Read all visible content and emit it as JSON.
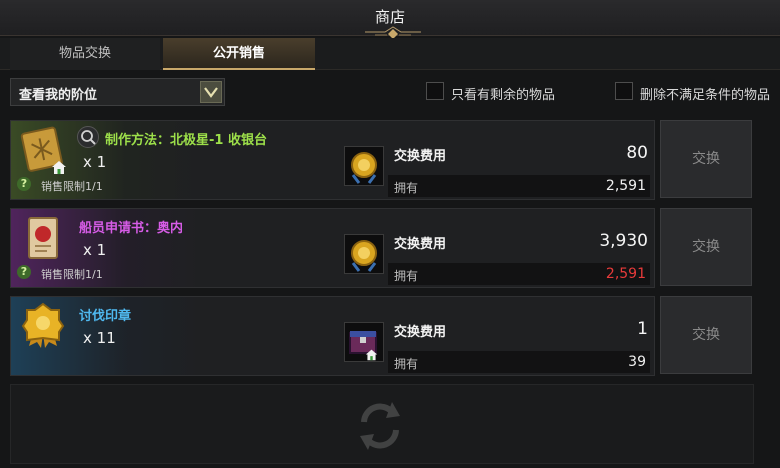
{
  "window": {
    "title": "商店"
  },
  "tabs": [
    {
      "label": "物品交换",
      "active": false
    },
    {
      "label": "公开销售",
      "active": true
    }
  ],
  "filter": {
    "dropdown_value": "查看我的阶位",
    "checkbox1_label": "只看有剩余的物品",
    "checkbox2_label": "删除不满足条件的物品"
  },
  "items": [
    {
      "name": "制作方法：北极星-1 收银台",
      "name_color": "#9de04a",
      "quantity": "x 1",
      "limit": "销售限制1/1",
      "cost_label": "交换费用",
      "cost": "80",
      "owned_label": "拥有",
      "owned": "2,591",
      "owned_insufficient": false,
      "button": "交换"
    },
    {
      "name": "船员申请书：奥内",
      "name_color": "#d65ce6",
      "quantity": "x 1",
      "limit": "销售限制1/1",
      "cost_label": "交换费用",
      "cost": "3,930",
      "owned_label": "拥有",
      "owned": "2,591",
      "owned_insufficient": true,
      "button": "交换"
    },
    {
      "name": "讨伐印章",
      "name_color": "#4fb8ef",
      "quantity": "x 11",
      "cost_label": "交换费用",
      "cost": "1",
      "owned_label": "拥有",
      "owned": "39",
      "owned_insufficient": false,
      "button": "交换"
    }
  ],
  "icons": {
    "item1": "recipe-scroll-icon",
    "item2": "crew-application-icon",
    "item3": "gold-medal-icon",
    "currency_gold": "gold-coin-icon",
    "currency_chest": "chest-icon"
  }
}
